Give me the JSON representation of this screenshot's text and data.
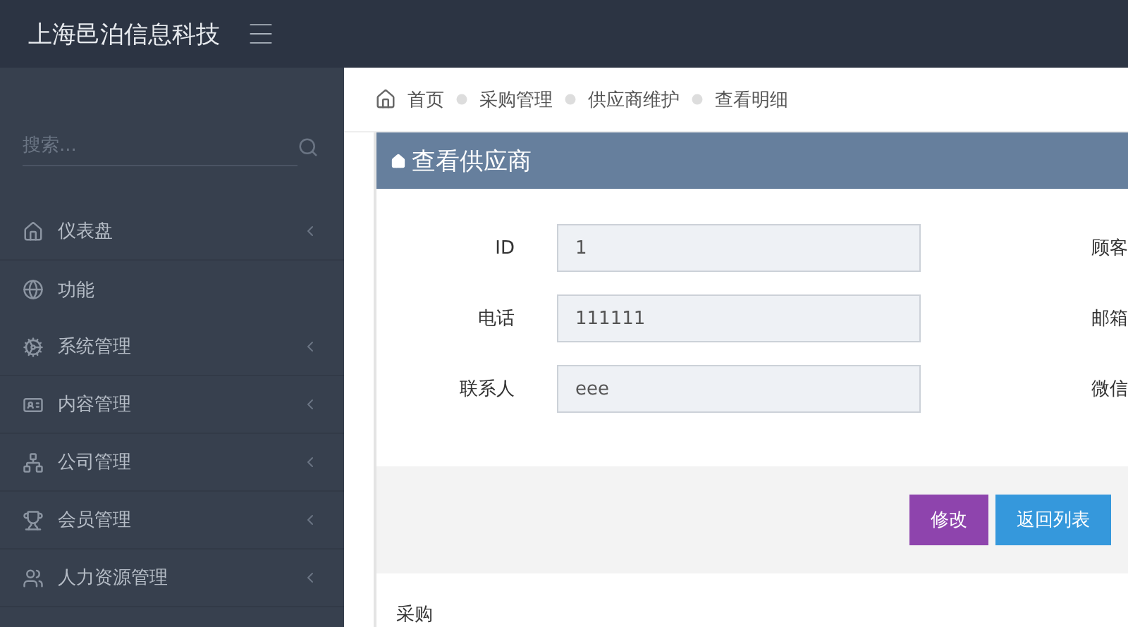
{
  "header": {
    "title": "上海邑泊信息科技"
  },
  "sidebar": {
    "search": {
      "placeholder": "搜索..."
    },
    "items": [
      {
        "kind": "link",
        "label": "仪表盘"
      },
      {
        "kind": "section",
        "label": "功能"
      },
      {
        "kind": "link",
        "label": "系统管理"
      },
      {
        "kind": "link",
        "label": "内容管理"
      },
      {
        "kind": "link",
        "label": "公司管理"
      },
      {
        "kind": "link",
        "label": "会员管理"
      },
      {
        "kind": "link",
        "label": "人力资源管理"
      }
    ]
  },
  "breadcrumb": [
    "首页",
    "采购管理",
    "供应商维护",
    "查看明细"
  ],
  "panel": {
    "title": "查看供应商",
    "fields": [
      {
        "label": "ID",
        "value": "1",
        "right_label": "顾客"
      },
      {
        "label": "电话",
        "value": "111111",
        "right_label": "邮箱"
      },
      {
        "label": "联系人",
        "value": "eee",
        "right_label": "微信"
      }
    ],
    "buttons": [
      {
        "kind": "edit",
        "label": "修改"
      },
      {
        "kind": "back",
        "label": "返回列表"
      }
    ]
  },
  "next_section": {
    "title": "采购"
  }
}
